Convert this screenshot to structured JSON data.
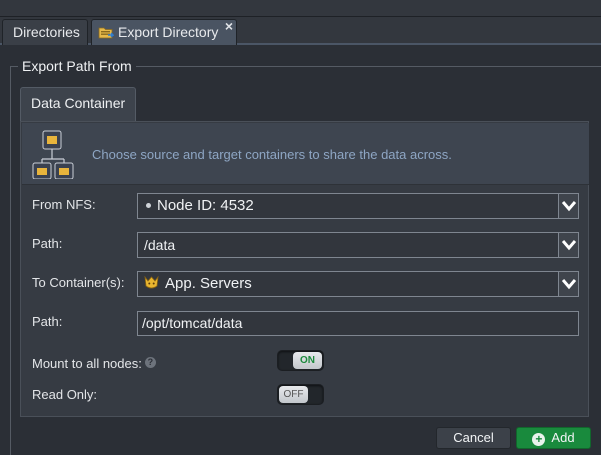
{
  "tabs": [
    {
      "label": "Directories",
      "active": false
    },
    {
      "label": "Export Directory",
      "active": true,
      "icon": "export-directory-icon",
      "close": "×"
    }
  ],
  "section": {
    "legend": "Export Path From"
  },
  "inner_tab": {
    "label": "Data Container"
  },
  "banner": {
    "text": "Choose source and target containers to share the data across.",
    "icon": "container-tree-icon"
  },
  "form": {
    "from_nfs": {
      "label": "From NFS:",
      "value": "Node ID: 4532"
    },
    "source_path": {
      "label": "Path:",
      "value": "/data"
    },
    "to_containers": {
      "label": "To Container(s):",
      "value": "App. Servers",
      "icon": "app-servers-icon"
    },
    "target_path": {
      "label": "Path:",
      "value": "/opt/tomcat/data"
    },
    "mount_all": {
      "label": "Mount to all nodes:",
      "help": "?",
      "state": "ON"
    },
    "read_only": {
      "label": "Read Only:",
      "state": "OFF"
    }
  },
  "buttons": {
    "cancel": "Cancel",
    "add": "Add",
    "add_icon": "+"
  },
  "colors": {
    "accent_green": "#198a3d",
    "banner_text": "#8ea6c4",
    "background": "#2b2f36"
  }
}
